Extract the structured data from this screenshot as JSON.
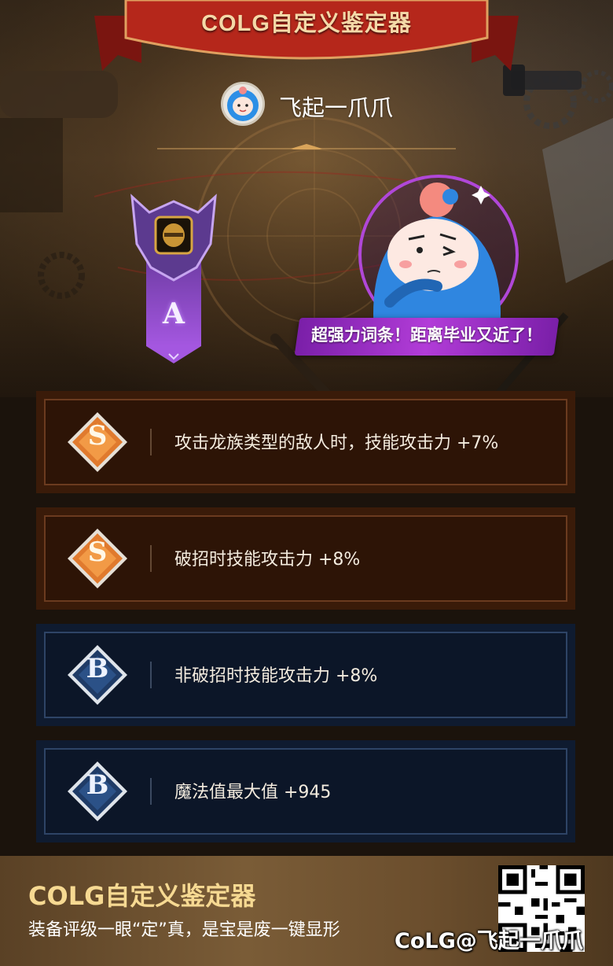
{
  "header": {
    "title": "COLG自定义鉴定器"
  },
  "user": {
    "name": "飞起一爪爪",
    "avatar_icon": "mascot-avatar-icon"
  },
  "rating": {
    "grade": "A",
    "icon": "helmet-badge-icon"
  },
  "mascot": {
    "icon": "blue-mascot-thinking-icon",
    "speech": "超强力词条！距离毕业又近了！"
  },
  "stats": [
    {
      "tier": "S",
      "text": "攻击龙族类型的敌人时，技能攻击力 +7%",
      "theme": "bronze"
    },
    {
      "tier": "S",
      "text": "破招时技能攻击力 +8%",
      "theme": "bronze"
    },
    {
      "tier": "B",
      "text": "非破招时技能攻击力 +8%",
      "theme": "blue"
    },
    {
      "tier": "B",
      "text": "魔法值最大值 +945",
      "theme": "blue"
    }
  ],
  "footer": {
    "title": "COLG自定义鉴定器",
    "subtitle": "装备评级一眼“定”真，是宝是废一键显形",
    "qr_icon": "qr-code-icon",
    "watermark": "CoLG@飞起一爪爪"
  },
  "colors": {
    "s_tier": "#e07a2e",
    "b_tier": "#1f3b66",
    "speech_bg": "#a331cf",
    "footer_title": "#f6d992"
  }
}
